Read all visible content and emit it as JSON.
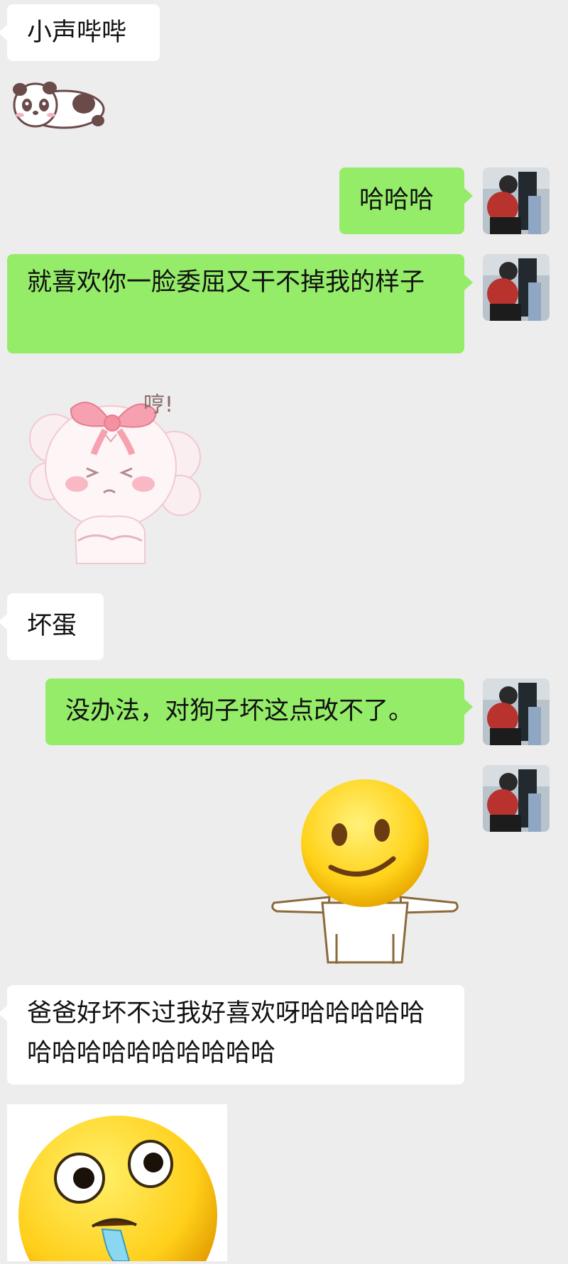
{
  "messages": [
    {
      "side": "in",
      "text": "小声哔哔"
    },
    {
      "side": "in",
      "sticker": "panda-sticker"
    },
    {
      "side": "out",
      "text": "哈哈哈"
    },
    {
      "side": "out",
      "text": "就喜欢你一脸委屈又干不掉我的样子"
    },
    {
      "side": "in",
      "sticker": "pink-bow-puppy-sticker",
      "sticker_text": "哼!"
    },
    {
      "side": "in",
      "text": "坏蛋"
    },
    {
      "side": "out",
      "text": "没办法，对狗子坏这点改不了。"
    },
    {
      "side": "out",
      "sticker": "shrug-smiley-sticker"
    },
    {
      "side": "in",
      "text": "爸爸好坏不过我好喜欢呀哈哈哈哈哈哈哈哈哈哈哈哈哈哈哈"
    },
    {
      "side": "in",
      "sticker": "drooling-emoji-sticker"
    }
  ],
  "colors": {
    "background": "#ededed",
    "incoming_bubble": "#ffffff",
    "outgoing_bubble": "#95ec69"
  }
}
